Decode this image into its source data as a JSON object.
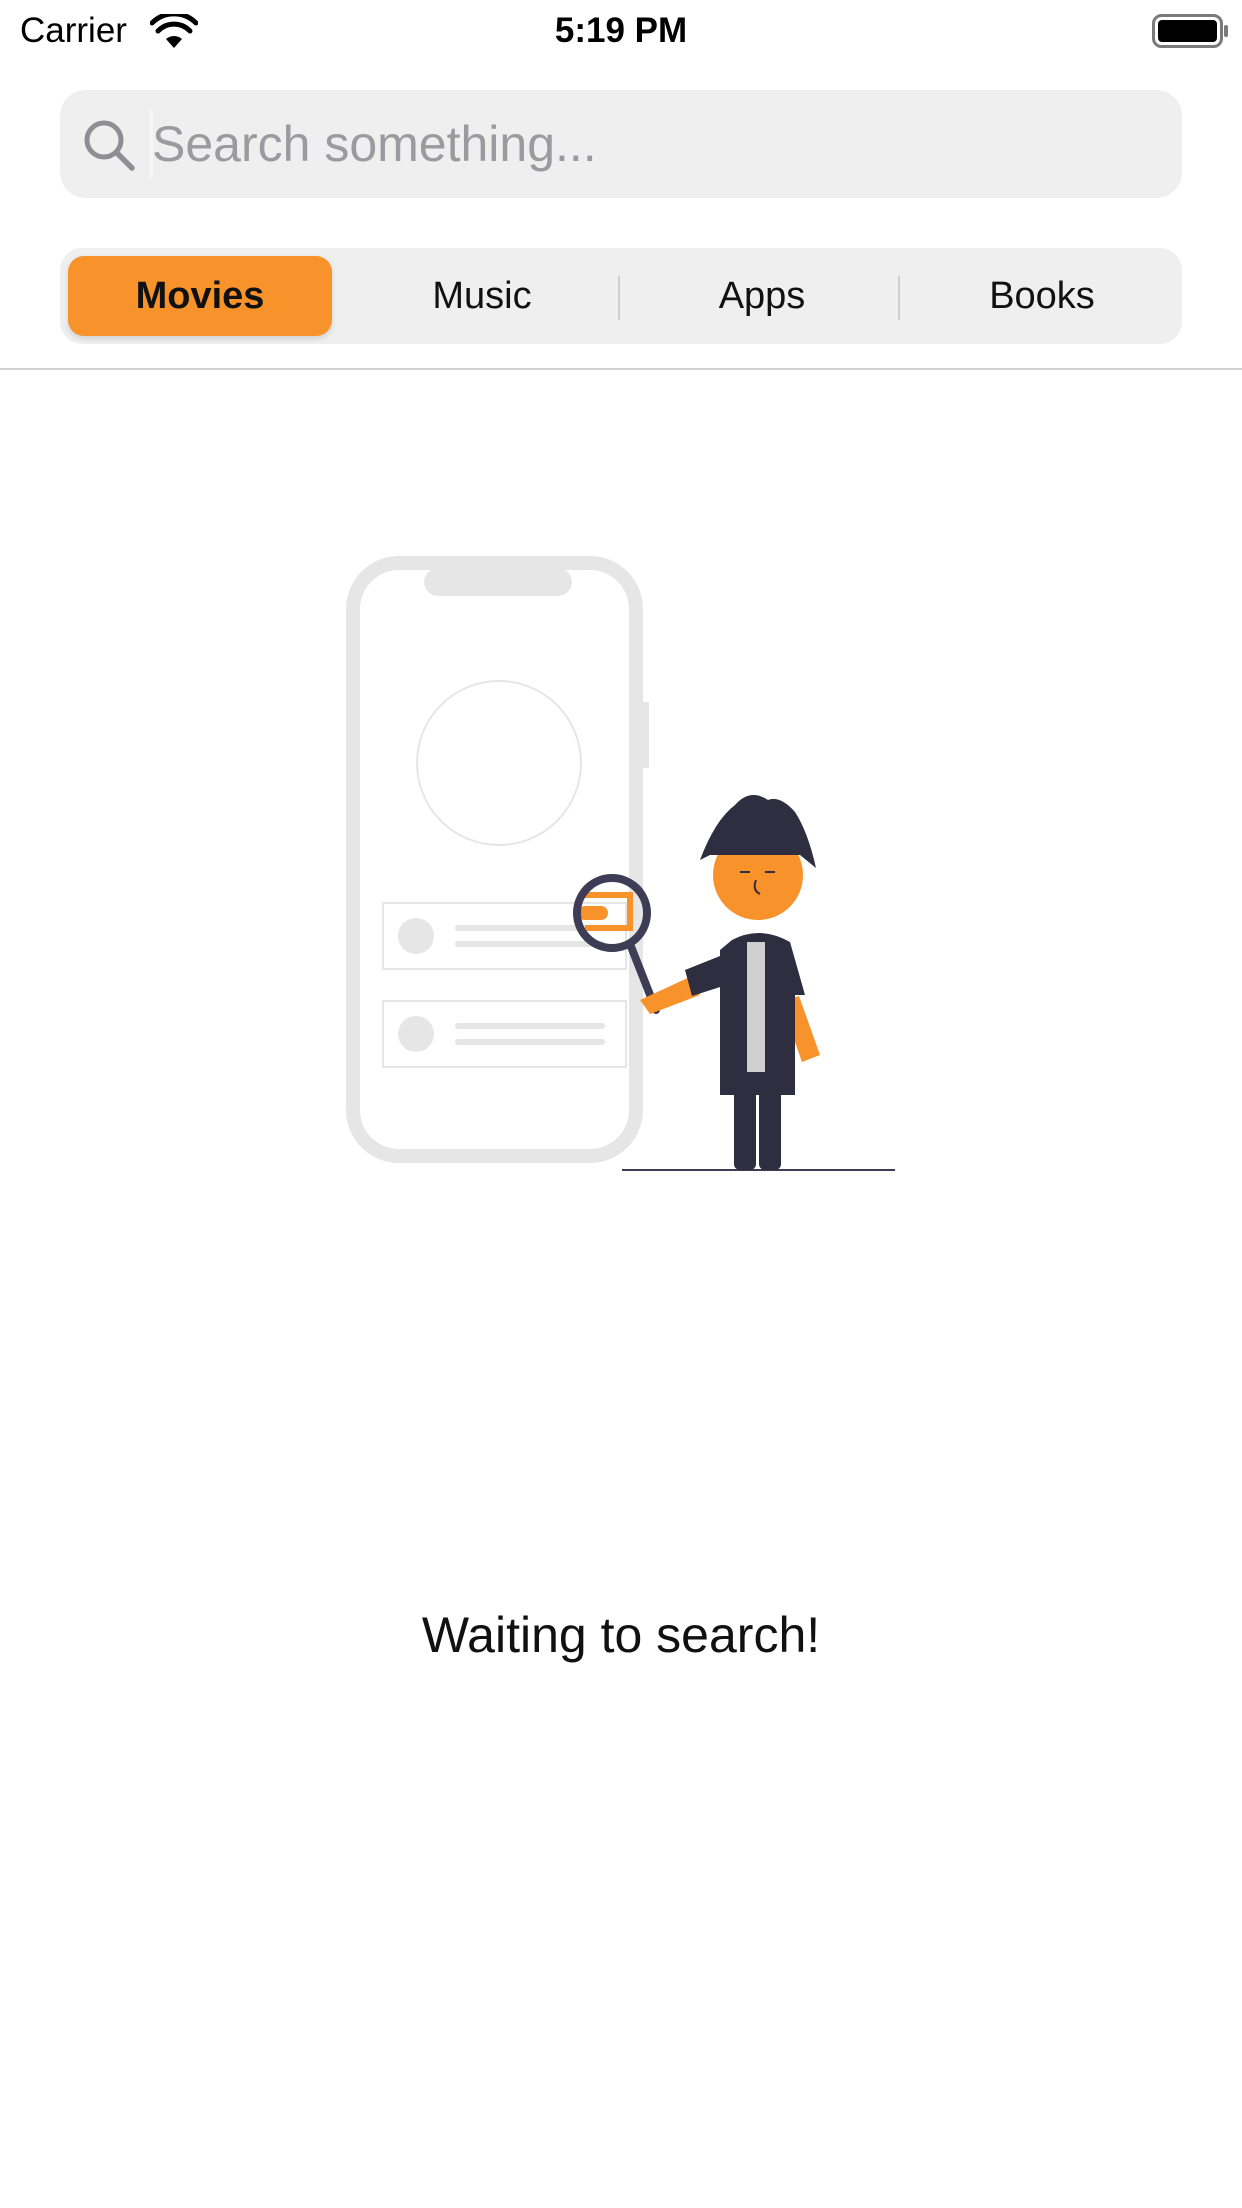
{
  "status_bar": {
    "carrier": "Carrier",
    "time": "5:19 PM",
    "icons": [
      "wifi-icon",
      "battery-icon"
    ]
  },
  "search": {
    "placeholder": "Search something...",
    "value": "",
    "icon": "search-icon"
  },
  "segments": {
    "items": [
      "Movies",
      "Music",
      "Apps",
      "Books"
    ],
    "selected": "Movies",
    "accent_color": "#f8922b"
  },
  "empty_state": {
    "message": "Waiting to search!",
    "illustration": "person-with-magnifier-illustration"
  }
}
